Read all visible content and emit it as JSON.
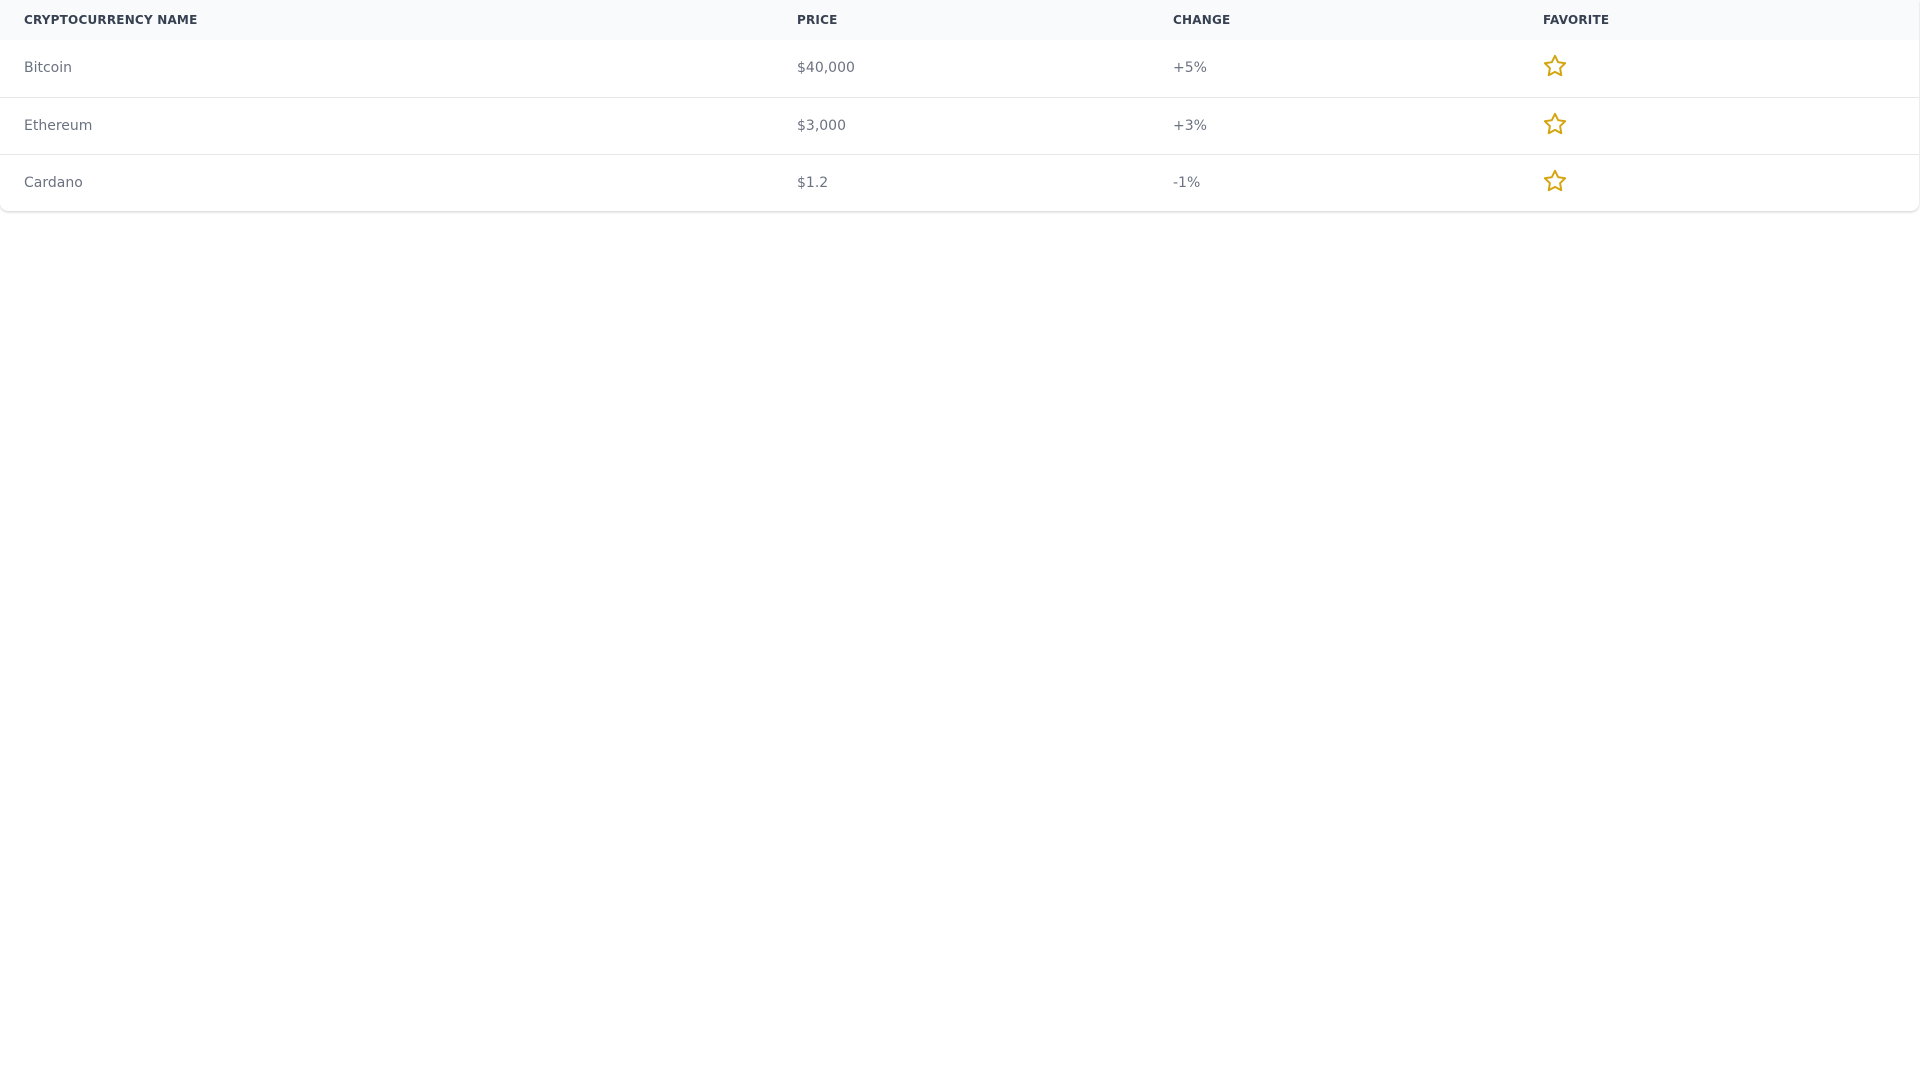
{
  "table": {
    "headers": [
      "Cryptocurrency Name",
      "Price",
      "Change",
      "Favorite"
    ],
    "rows": [
      {
        "name": "Bitcoin",
        "price": "$40,000",
        "change": "+5%",
        "favorite_icon": "star-outline-icon"
      },
      {
        "name": "Ethereum",
        "price": "$3,000",
        "change": "+3%",
        "favorite_icon": "star-outline-icon"
      },
      {
        "name": "Cardano",
        "price": "$1.2",
        "change": "-1%",
        "favorite_icon": "star-outline-icon"
      }
    ]
  },
  "colors": {
    "header_bg": "#f9fafb",
    "header_text": "#374151",
    "cell_text": "#6b7280",
    "divider": "#e5e7eb",
    "star": "#d4a50f"
  }
}
